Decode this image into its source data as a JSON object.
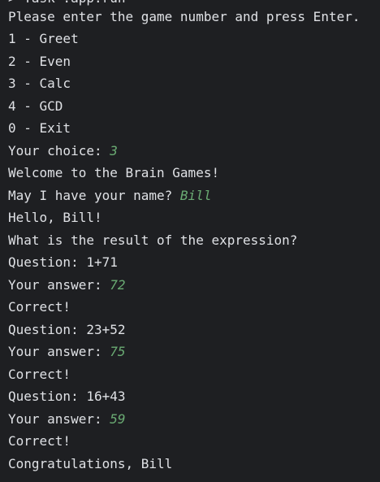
{
  "console": {
    "cut_line": "> Task :app:run",
    "prompt": "Please enter the game number and press Enter.",
    "menu": [
      "1 - Greet",
      "2 - Even",
      "3 - Calc",
      "4 - GCD",
      "0 - Exit"
    ],
    "choice_label": "Your choice: ",
    "choice_input": "3",
    "welcome": "Welcome to the Brain Games!",
    "name_prompt": "May I have your name? ",
    "name_input": "Bill",
    "hello": "Hello, Bill!",
    "task": "What is the result of the expression?",
    "rounds": [
      {
        "question": "Question: 1+71",
        "answer_label": "Your answer: ",
        "answer": "72",
        "result": "Correct!"
      },
      {
        "question": "Question: 23+52",
        "answer_label": "Your answer: ",
        "answer": "75",
        "result": "Correct!"
      },
      {
        "question": "Question: 16+43",
        "answer_label": "Your answer: ",
        "answer": "59",
        "result": "Correct!"
      }
    ],
    "final": "Congratulations, Bill",
    "colors": {
      "background": "#1e1f22",
      "text": "#dfe1e5",
      "user_input": "#6aab73"
    }
  }
}
